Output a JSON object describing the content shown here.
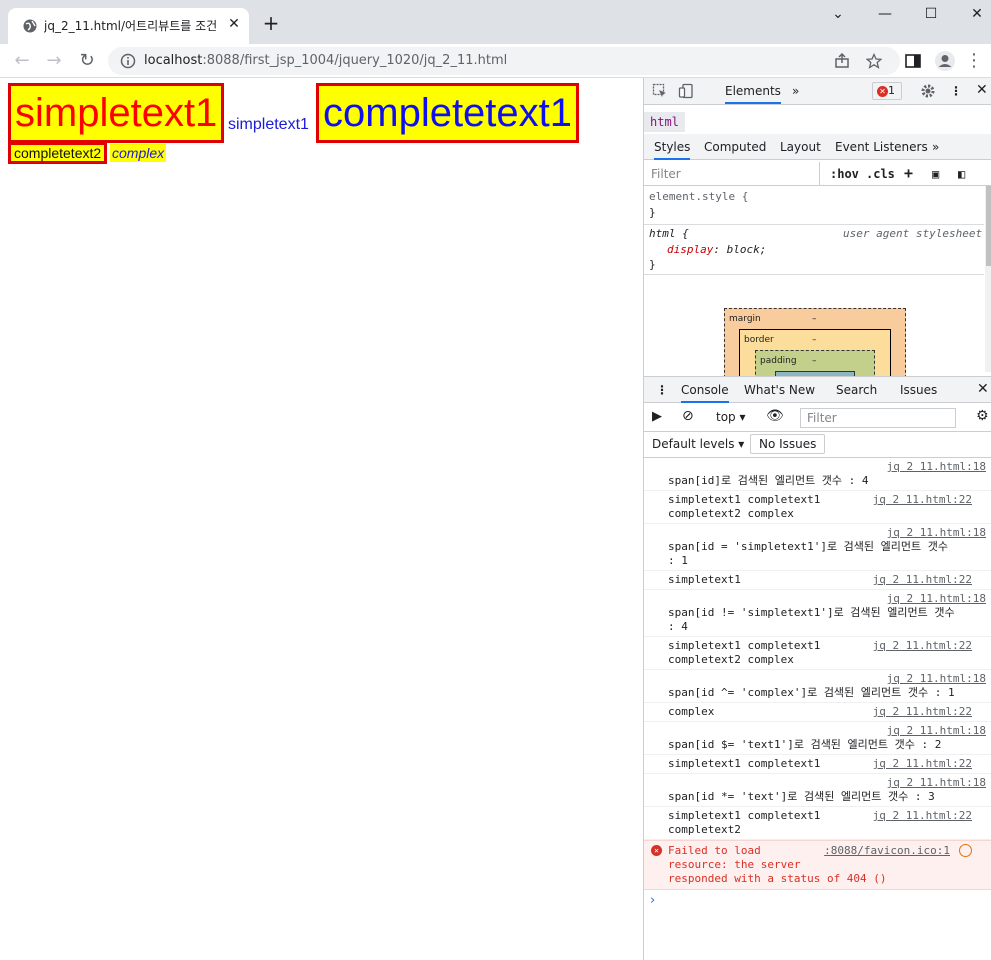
{
  "browser": {
    "tab_title": "jq_2_11.html/어트리뷰트를 조건",
    "url_host": "localhost",
    "url_path": ":8088/first_jsp_1004/jquery_1020/jq_2_11.html"
  },
  "page": {
    "simpletext1_box": "simpletext1",
    "simpletext1_plain": "simpletext1",
    "completetext1": "completetext1",
    "completetext2": "completetext2",
    "complex": "complex"
  },
  "devtools": {
    "main_tab": "Elements",
    "error_count": "1",
    "breadcrumb": "html",
    "subtabs": [
      "Styles",
      "Computed",
      "Layout",
      "Event Listeners"
    ],
    "filter_placeholder": "Filter",
    "hov": ":hov",
    "cls": ".cls",
    "rule1_selector": "element.style {",
    "rule1_close": "}",
    "rule2_selector": "html {",
    "rule2_source": "user agent stylesheet",
    "rule2_prop": "display",
    "rule2_value": "block;",
    "rule2_close": "}",
    "boxmodel": {
      "margin": "margin",
      "border": "border",
      "padding": "padding",
      "dash": "–"
    },
    "drawer_tabs": [
      "Console",
      "What's New",
      "Search",
      "Issues"
    ],
    "context": "top",
    "console_filter": "Filter",
    "default_levels": "Default levels",
    "no_issues": "No Issues",
    "logs": [
      {
        "src": "jq 2 11.html:18",
        "text": "span[id]로 검색된 엘리먼트 갯수 : 4"
      },
      {
        "src": "jq 2 11.html:22",
        "text": "simpletext1 completext1\ncompletext2 complex"
      },
      {
        "src": "jq 2 11.html:18",
        "text": "span[id = 'simpletext1']로 검색된 엘리먼트 갯수\n: 1"
      },
      {
        "src": "jq 2 11.html:22",
        "text": "simpletext1"
      },
      {
        "src": "jq 2 11.html:18",
        "text": "span[id != 'simpletext1']로 검색된 엘리먼트 갯수\n: 4"
      },
      {
        "src": "jq 2 11.html:22",
        "text": "simpletext1 completext1\ncompletext2 complex"
      },
      {
        "src": "jq 2 11.html:18",
        "text": "span[id ^= 'complex']로 검색된 엘리먼트 갯수 : 1"
      },
      {
        "src": "jq 2 11.html:22",
        "text": "complex"
      },
      {
        "src": "jq 2 11.html:18",
        "text": "span[id $= 'text1']로 검색된 엘리먼트 갯수 : 2"
      },
      {
        "src": "jq 2 11.html:22",
        "text": "simpletext1 completext1"
      },
      {
        "src": "jq 2 11.html:18",
        "text": "span[id *= 'text']로 검색된 엘리먼트 갯수 : 3"
      },
      {
        "src": "jq 2 11.html:22",
        "text": "simpletext1 completext1\ncompletext2"
      }
    ],
    "error": {
      "text": "Failed to load\nresource: the server\nresponded with a status of 404 ()",
      "src": ":8088/favicon.ico:1"
    },
    "prompt": "›"
  }
}
